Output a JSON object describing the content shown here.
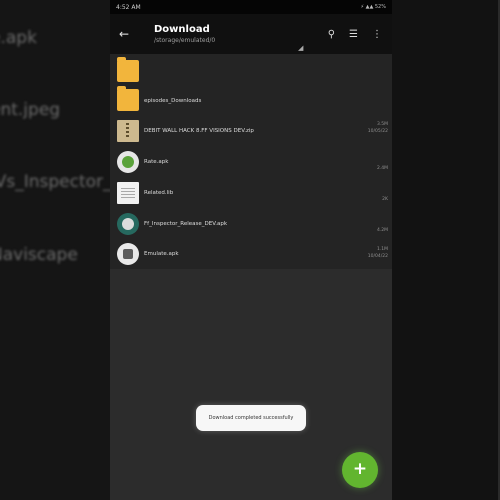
{
  "background": {
    "texts": [
      "e.apk",
      "ent.jpeg",
      "iVs_Inspector_X",
      "Naviscape"
    ]
  },
  "status_bar": {
    "time": "4:52 AM",
    "indicators": "⚡ ▲▲ 52%"
  },
  "app_bar": {
    "title": "Download",
    "path": "/storage/emulated/0",
    "back_icon": "back-arrow-icon",
    "actions": [
      "search-icon",
      "list-view-icon",
      "more-icon"
    ]
  },
  "files": [
    {
      "name": "",
      "type": "folder",
      "meta": []
    },
    {
      "name": "episodes_Downloads",
      "type": "folder",
      "meta": []
    },
    {
      "name": "DEBIT WALL HACK 8.FF VISIONS DEV.zip",
      "type": "zip",
      "meta": [
        "3.5M",
        "10/05/22"
      ]
    },
    {
      "name": "Rate.apk",
      "type": "apk",
      "meta": [
        "2.4M"
      ]
    },
    {
      "name": "Related.lib",
      "type": "doc",
      "meta": [
        "2K"
      ]
    },
    {
      "name": "Ff_Inspector_Release_DEV.apk",
      "type": "appicon",
      "meta": [
        "4.2M"
      ]
    },
    {
      "name": "Emulate.apk",
      "type": "grayapp",
      "meta": [
        "1.1M",
        "10/04/22"
      ]
    }
  ],
  "toast": "Download completed successfully",
  "fab": {
    "symbol": "+",
    "icon": "add-icon"
  },
  "colors": {
    "accent": "#62b52f",
    "folder": "#f2b53c",
    "appbar": "#101010",
    "list_bg": "#242424",
    "body_bg": "#2c2c2c"
  }
}
